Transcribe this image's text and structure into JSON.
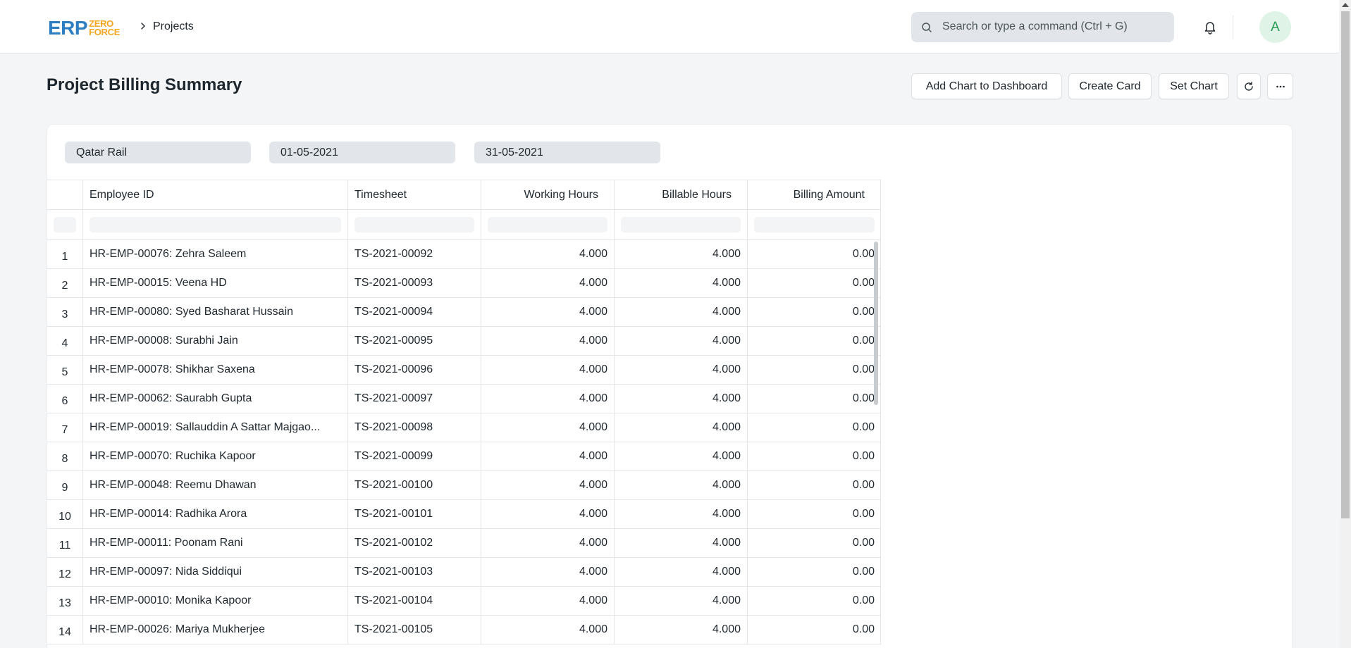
{
  "navbar": {
    "logo_main": "ERP",
    "logo_top": "ZERO",
    "logo_bottom": "FORCE",
    "breadcrumb": "Projects",
    "search_placeholder": "Search or type a command (Ctrl + G)",
    "avatar_initial": "A"
  },
  "page": {
    "title": "Project Billing Summary",
    "buttons": {
      "add_chart": "Add Chart to Dashboard",
      "create_card": "Create Card",
      "set_chart": "Set Chart"
    }
  },
  "filters": {
    "project": "Qatar Rail",
    "from_date": "01-05-2021",
    "to_date": "31-05-2021"
  },
  "table": {
    "columns": [
      "Employee ID",
      "Timesheet",
      "Working Hours",
      "Billable Hours",
      "Billing Amount"
    ],
    "rows": [
      {
        "n": "1",
        "employee": "HR-EMP-00076: Zehra Saleem",
        "timesheet": "TS-2021-00092",
        "working": "4.000",
        "billable": "4.000",
        "amount": "0.00"
      },
      {
        "n": "2",
        "employee": "HR-EMP-00015: Veena HD",
        "timesheet": "TS-2021-00093",
        "working": "4.000",
        "billable": "4.000",
        "amount": "0.00"
      },
      {
        "n": "3",
        "employee": "HR-EMP-00080: Syed Basharat Hussain",
        "timesheet": "TS-2021-00094",
        "working": "4.000",
        "billable": "4.000",
        "amount": "0.00"
      },
      {
        "n": "4",
        "employee": "HR-EMP-00008: Surabhi Jain",
        "timesheet": "TS-2021-00095",
        "working": "4.000",
        "billable": "4.000",
        "amount": "0.00"
      },
      {
        "n": "5",
        "employee": "HR-EMP-00078: Shikhar Saxena",
        "timesheet": "TS-2021-00096",
        "working": "4.000",
        "billable": "4.000",
        "amount": "0.00"
      },
      {
        "n": "6",
        "employee": "HR-EMP-00062: Saurabh Gupta",
        "timesheet": "TS-2021-00097",
        "working": "4.000",
        "billable": "4.000",
        "amount": "0.00"
      },
      {
        "n": "7",
        "employee": "HR-EMP-00019: Sallauddin A Sattar Majgao...",
        "timesheet": "TS-2021-00098",
        "working": "4.000",
        "billable": "4.000",
        "amount": "0.00"
      },
      {
        "n": "8",
        "employee": "HR-EMP-00070: Ruchika Kapoor",
        "timesheet": "TS-2021-00099",
        "working": "4.000",
        "billable": "4.000",
        "amount": "0.00"
      },
      {
        "n": "9",
        "employee": "HR-EMP-00048: Reemu Dhawan",
        "timesheet": "TS-2021-00100",
        "working": "4.000",
        "billable": "4.000",
        "amount": "0.00"
      },
      {
        "n": "10",
        "employee": "HR-EMP-00014: Radhika Arora",
        "timesheet": "TS-2021-00101",
        "working": "4.000",
        "billable": "4.000",
        "amount": "0.00"
      },
      {
        "n": "11",
        "employee": "HR-EMP-00011: Poonam Rani",
        "timesheet": "TS-2021-00102",
        "working": "4.000",
        "billable": "4.000",
        "amount": "0.00"
      },
      {
        "n": "12",
        "employee": "HR-EMP-00097: Nida Siddiqui",
        "timesheet": "TS-2021-00103",
        "working": "4.000",
        "billable": "4.000",
        "amount": "0.00"
      },
      {
        "n": "13",
        "employee": "HR-EMP-00010: Monika Kapoor",
        "timesheet": "TS-2021-00104",
        "working": "4.000",
        "billable": "4.000",
        "amount": "0.00"
      },
      {
        "n": "14",
        "employee": "HR-EMP-00026: Mariya Mukherjee",
        "timesheet": "TS-2021-00105",
        "working": "4.000",
        "billable": "4.000",
        "amount": "0.00"
      }
    ]
  },
  "icons": {
    "search": "search-icon",
    "bell": "bell-icon",
    "refresh": "refresh-icon",
    "more": "more-icon",
    "breadcrumb_chevron": "chevron-right-icon"
  },
  "colors": {
    "logo_blue": "#2d7fc1",
    "logo_orange": "#f4a623",
    "avatar_bg": "#dff3e6",
    "avatar_fg": "#2c9a56"
  }
}
